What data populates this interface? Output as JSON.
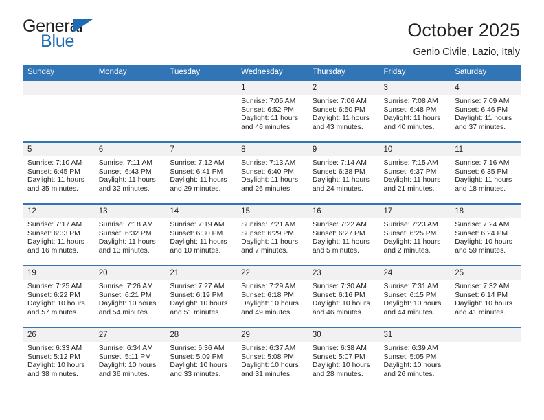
{
  "brand": {
    "word_one": "General",
    "word_two": "Blue",
    "accent_color": "#1f6cb4"
  },
  "header": {
    "title": "October 2025",
    "subtitle": "Genio Civile, Lazio, Italy"
  },
  "calendar": {
    "header_bg": "#3175b6",
    "weekday_headers": [
      "Sunday",
      "Monday",
      "Tuesday",
      "Wednesday",
      "Thursday",
      "Friday",
      "Saturday"
    ],
    "labels": {
      "sunrise": "Sunrise:",
      "sunset": "Sunset:",
      "daylight": "Daylight:"
    },
    "weeks": [
      [
        {
          "day": "",
          "empty": true
        },
        {
          "day": "",
          "empty": true
        },
        {
          "day": "",
          "empty": true
        },
        {
          "day": "1",
          "sunrise": "Sunrise: 7:05 AM",
          "sunset": "Sunset: 6:52 PM",
          "daylight_line1": "Daylight: 11 hours",
          "daylight_line2": "and 46 minutes."
        },
        {
          "day": "2",
          "sunrise": "Sunrise: 7:06 AM",
          "sunset": "Sunset: 6:50 PM",
          "daylight_line1": "Daylight: 11 hours",
          "daylight_line2": "and 43 minutes."
        },
        {
          "day": "3",
          "sunrise": "Sunrise: 7:08 AM",
          "sunset": "Sunset: 6:48 PM",
          "daylight_line1": "Daylight: 11 hours",
          "daylight_line2": "and 40 minutes."
        },
        {
          "day": "4",
          "sunrise": "Sunrise: 7:09 AM",
          "sunset": "Sunset: 6:46 PM",
          "daylight_line1": "Daylight: 11 hours",
          "daylight_line2": "and 37 minutes."
        }
      ],
      [
        {
          "day": "5",
          "sunrise": "Sunrise: 7:10 AM",
          "sunset": "Sunset: 6:45 PM",
          "daylight_line1": "Daylight: 11 hours",
          "daylight_line2": "and 35 minutes."
        },
        {
          "day": "6",
          "sunrise": "Sunrise: 7:11 AM",
          "sunset": "Sunset: 6:43 PM",
          "daylight_line1": "Daylight: 11 hours",
          "daylight_line2": "and 32 minutes."
        },
        {
          "day": "7",
          "sunrise": "Sunrise: 7:12 AM",
          "sunset": "Sunset: 6:41 PM",
          "daylight_line1": "Daylight: 11 hours",
          "daylight_line2": "and 29 minutes."
        },
        {
          "day": "8",
          "sunrise": "Sunrise: 7:13 AM",
          "sunset": "Sunset: 6:40 PM",
          "daylight_line1": "Daylight: 11 hours",
          "daylight_line2": "and 26 minutes."
        },
        {
          "day": "9",
          "sunrise": "Sunrise: 7:14 AM",
          "sunset": "Sunset: 6:38 PM",
          "daylight_line1": "Daylight: 11 hours",
          "daylight_line2": "and 24 minutes."
        },
        {
          "day": "10",
          "sunrise": "Sunrise: 7:15 AM",
          "sunset": "Sunset: 6:37 PM",
          "daylight_line1": "Daylight: 11 hours",
          "daylight_line2": "and 21 minutes."
        },
        {
          "day": "11",
          "sunrise": "Sunrise: 7:16 AM",
          "sunset": "Sunset: 6:35 PM",
          "daylight_line1": "Daylight: 11 hours",
          "daylight_line2": "and 18 minutes."
        }
      ],
      [
        {
          "day": "12",
          "sunrise": "Sunrise: 7:17 AM",
          "sunset": "Sunset: 6:33 PM",
          "daylight_line1": "Daylight: 11 hours",
          "daylight_line2": "and 16 minutes."
        },
        {
          "day": "13",
          "sunrise": "Sunrise: 7:18 AM",
          "sunset": "Sunset: 6:32 PM",
          "daylight_line1": "Daylight: 11 hours",
          "daylight_line2": "and 13 minutes."
        },
        {
          "day": "14",
          "sunrise": "Sunrise: 7:19 AM",
          "sunset": "Sunset: 6:30 PM",
          "daylight_line1": "Daylight: 11 hours",
          "daylight_line2": "and 10 minutes."
        },
        {
          "day": "15",
          "sunrise": "Sunrise: 7:21 AM",
          "sunset": "Sunset: 6:29 PM",
          "daylight_line1": "Daylight: 11 hours",
          "daylight_line2": "and 7 minutes."
        },
        {
          "day": "16",
          "sunrise": "Sunrise: 7:22 AM",
          "sunset": "Sunset: 6:27 PM",
          "daylight_line1": "Daylight: 11 hours",
          "daylight_line2": "and 5 minutes."
        },
        {
          "day": "17",
          "sunrise": "Sunrise: 7:23 AM",
          "sunset": "Sunset: 6:25 PM",
          "daylight_line1": "Daylight: 11 hours",
          "daylight_line2": "and 2 minutes."
        },
        {
          "day": "18",
          "sunrise": "Sunrise: 7:24 AM",
          "sunset": "Sunset: 6:24 PM",
          "daylight_line1": "Daylight: 10 hours",
          "daylight_line2": "and 59 minutes."
        }
      ],
      [
        {
          "day": "19",
          "sunrise": "Sunrise: 7:25 AM",
          "sunset": "Sunset: 6:22 PM",
          "daylight_line1": "Daylight: 10 hours",
          "daylight_line2": "and 57 minutes."
        },
        {
          "day": "20",
          "sunrise": "Sunrise: 7:26 AM",
          "sunset": "Sunset: 6:21 PM",
          "daylight_line1": "Daylight: 10 hours",
          "daylight_line2": "and 54 minutes."
        },
        {
          "day": "21",
          "sunrise": "Sunrise: 7:27 AM",
          "sunset": "Sunset: 6:19 PM",
          "daylight_line1": "Daylight: 10 hours",
          "daylight_line2": "and 51 minutes."
        },
        {
          "day": "22",
          "sunrise": "Sunrise: 7:29 AM",
          "sunset": "Sunset: 6:18 PM",
          "daylight_line1": "Daylight: 10 hours",
          "daylight_line2": "and 49 minutes."
        },
        {
          "day": "23",
          "sunrise": "Sunrise: 7:30 AM",
          "sunset": "Sunset: 6:16 PM",
          "daylight_line1": "Daylight: 10 hours",
          "daylight_line2": "and 46 minutes."
        },
        {
          "day": "24",
          "sunrise": "Sunrise: 7:31 AM",
          "sunset": "Sunset: 6:15 PM",
          "daylight_line1": "Daylight: 10 hours",
          "daylight_line2": "and 44 minutes."
        },
        {
          "day": "25",
          "sunrise": "Sunrise: 7:32 AM",
          "sunset": "Sunset: 6:14 PM",
          "daylight_line1": "Daylight: 10 hours",
          "daylight_line2": "and 41 minutes."
        }
      ],
      [
        {
          "day": "26",
          "sunrise": "Sunrise: 6:33 AM",
          "sunset": "Sunset: 5:12 PM",
          "daylight_line1": "Daylight: 10 hours",
          "daylight_line2": "and 38 minutes."
        },
        {
          "day": "27",
          "sunrise": "Sunrise: 6:34 AM",
          "sunset": "Sunset: 5:11 PM",
          "daylight_line1": "Daylight: 10 hours",
          "daylight_line2": "and 36 minutes."
        },
        {
          "day": "28",
          "sunrise": "Sunrise: 6:36 AM",
          "sunset": "Sunset: 5:09 PM",
          "daylight_line1": "Daylight: 10 hours",
          "daylight_line2": "and 33 minutes."
        },
        {
          "day": "29",
          "sunrise": "Sunrise: 6:37 AM",
          "sunset": "Sunset: 5:08 PM",
          "daylight_line1": "Daylight: 10 hours",
          "daylight_line2": "and 31 minutes."
        },
        {
          "day": "30",
          "sunrise": "Sunrise: 6:38 AM",
          "sunset": "Sunset: 5:07 PM",
          "daylight_line1": "Daylight: 10 hours",
          "daylight_line2": "and 28 minutes."
        },
        {
          "day": "31",
          "sunrise": "Sunrise: 6:39 AM",
          "sunset": "Sunset: 5:05 PM",
          "daylight_line1": "Daylight: 10 hours",
          "daylight_line2": "and 26 minutes."
        },
        {
          "day": "",
          "empty": true
        }
      ]
    ]
  }
}
